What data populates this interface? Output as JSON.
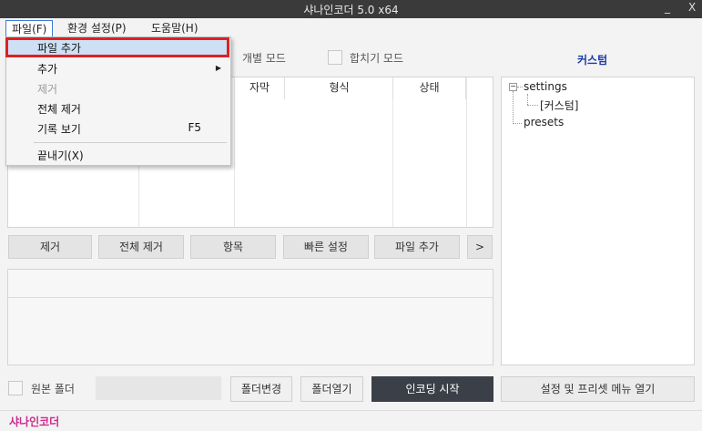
{
  "window": {
    "title": "샤나인코더  5.0  x64",
    "minimize": "_",
    "close": "X"
  },
  "menubar": {
    "file": "파일(F)",
    "settings": "환경 설정(P)",
    "help": "도움말(H)"
  },
  "mode": {
    "individual": "개별 모드",
    "merge": "합치기 모드"
  },
  "filelist": {
    "columns": [
      "자막",
      "형식",
      "상태"
    ]
  },
  "buttons": {
    "remove": "제거",
    "remove_all": "전체 제거",
    "items": "항목",
    "quick_settings": "빠른 설정",
    "add_file": "파일 추가",
    "more": ">"
  },
  "preset_panel": {
    "header": "커스텀",
    "tree": {
      "settings": "settings",
      "custom": "[커스텀]",
      "presets": "presets"
    },
    "collapse_symbol": "−"
  },
  "bottom": {
    "source_folder": "원본 폴더",
    "change_folder": "폴더변경",
    "open_folder": "폴더열기",
    "start_encoding": "인코딩 시작",
    "open_menu": "설정 및 프리셋 메뉴 열기"
  },
  "footer": {
    "brand": "샤나인코더"
  },
  "file_menu": {
    "items": [
      "파일 추가",
      "추가",
      "제거",
      "전체 제거",
      "기록 보기",
      "끝내기(X)"
    ],
    "shortcut_history": "F5",
    "submenu_arrow": "▶"
  },
  "colors": {
    "titlebar": "#3a3a3a",
    "start_button": "#3b3f47",
    "brand": "#cc2a8c",
    "preset_header": "#1a3aa8",
    "highlight_outline": "#e02020"
  }
}
